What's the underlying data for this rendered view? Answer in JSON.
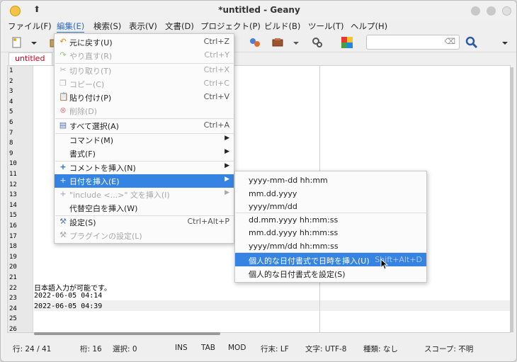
{
  "window": {
    "title": "*untitled - Geany"
  },
  "menubar": [
    "ファイル(F)",
    "編集(E)",
    "検索(S)",
    "表示(V)",
    "文書(D)",
    "プロジェクト(P)",
    "ビルド(B)",
    "ツール(T)",
    "ヘルプ(H)"
  ],
  "tab": {
    "label": "untitled"
  },
  "editor": {
    "line_numbers": [
      "1",
      "2",
      "3",
      "4",
      "5",
      "6",
      "7",
      "8",
      "9",
      "10",
      "11",
      "12",
      "13",
      "14",
      "15",
      "16",
      "17",
      "18",
      "19",
      "20",
      "21",
      "22",
      "23",
      "24",
      "25",
      "26"
    ],
    "lines": {
      "l22": "日本語入力が可能です。",
      "l23": "2022-06-05 04:14",
      "l24": "2022-06-05 04:39"
    }
  },
  "edit_menu": {
    "undo": {
      "label": "元に戻す(U)",
      "shortcut": "Ctrl+Z"
    },
    "redo": {
      "label": "やり直す(R)",
      "shortcut": "Ctrl+Y"
    },
    "cut": {
      "label": "切り取り(T)",
      "shortcut": "Ctrl+X"
    },
    "copy": {
      "label": "コピー(C)",
      "shortcut": "Ctrl+C"
    },
    "paste": {
      "label": "貼り付け(P)",
      "shortcut": "Ctrl+V"
    },
    "delete": {
      "label": "削除(D)"
    },
    "select_all": {
      "label": "すべて選択(A)",
      "shortcut": "Ctrl+A"
    },
    "commands": {
      "label": "コマンド(M)"
    },
    "format": {
      "label": "書式(F)"
    },
    "insert_comment": {
      "label": "コメントを挿入(N)"
    },
    "insert_date": {
      "label": "日付を挿入(E)"
    },
    "insert_include": {
      "label": "\"include <...>\" 文を挿入(I)"
    },
    "insert_alt_whitespace": {
      "label": "代替空白を挿入(W)"
    },
    "preferences": {
      "label": "設定(S)",
      "shortcut": "Ctrl+Alt+P"
    },
    "plugin_prefs": {
      "label": "プラグインの設定(L)"
    }
  },
  "date_submenu": {
    "items": [
      "yyyy-mm-dd hh:mm",
      "mm.dd.yyyy",
      "yyyy/mm/dd",
      "dd.mm.yyyy hh:mm:ss",
      "mm.dd.yyyy hh:mm:ss",
      "yyyy/mm/dd hh:mm:ss"
    ],
    "custom_insert": {
      "label": "個人的な日付書式で日時を挿入(U)",
      "shortcut": "Shift+Alt+D"
    },
    "custom_set": {
      "label": "個人的な日付書式を設定(S)"
    }
  },
  "statusbar": {
    "line": "行: 24 / 41",
    "col": "桁: 16",
    "sel": "選択: 0",
    "ins": "INS",
    "tab": "TAB",
    "mod": "MOD",
    "eol": "行末: LF",
    "enc": "文字: UTF-8",
    "type": "種類: なし",
    "scope": "スコープ: 不明"
  },
  "colors": {
    "accent": "#3584e4",
    "tab_text": "#d0021b",
    "menu_active": "#2a6dc4"
  }
}
